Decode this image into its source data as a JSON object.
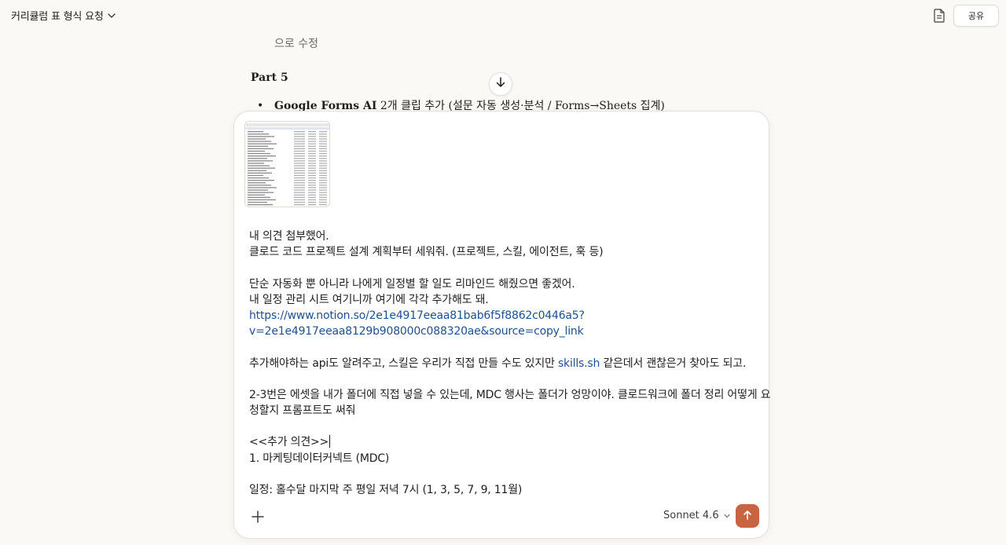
{
  "header": {
    "title": "커리큘럼 표 형식 요청",
    "share_label": "공유",
    "icons": [
      "chevron-down-icon",
      "document-icon"
    ]
  },
  "conversation": {
    "fade_line": "으로 수정",
    "part_heading": "Part 5",
    "bullet_bold": "Google Forms AI",
    "bullet_rest": " 2개 클립 추가 (설문 자동 생성·분석 / Forms→Sheets 집계)"
  },
  "composer": {
    "lines": [
      "내 의견 첨부했어.",
      "클로드 코드 프로젝트 설계 계획부터 세워줘. (프로젝트, 스킬, 에이전트, 훅 등)",
      "",
      "단순 자동화 뿐 아니라 나에게 일정별 할 일도 리마인드 해줬으면 좋겠어.",
      "내 일정 관리 시트 여기니까 여기에 각각 추가해도 돼.",
      "https://www.notion.so/2e1e4917eeaa81bab6f5f8862c0446a5?",
      "v=2e1e4917eeaa8129b908000c088320ae&source=copy_link",
      "",
      "추가해야하는 api도 알려주고, 스킬은 우리가 직접 만들 수도 있지만 skills.sh 같은데서 괜찮은거 찾아도 되고.",
      "",
      "2-3번은 에셋을 내가 폴더에 직접 넣을 수 있는데, MDC 행사는 폴더가 엉망이야. 클로드워크에 폴더 정리 어떻게 요",
      "청할지 프롬프트도 써줘",
      "",
      "<<추가 의견>>",
      "1. 마케팅데이터커넥트 (MDC)",
      "",
      "일정: 홀수달 마지막 주 평일 저녁 7시 (1, 3, 5, 7, 9, 11월)"
    ],
    "line_8_prefix": "추가해야하는 api도 알려주고, 스킬은 우리가 직접 만들 수도 있지만 ",
    "line_8_link": "skills.sh",
    "line_8_suffix": " 같은데서 괜찮은거 찾아도 되고.",
    "model_label": "Sonnet 4.6",
    "accent_color": "#c96442",
    "link_color": "#1f4f8f"
  }
}
